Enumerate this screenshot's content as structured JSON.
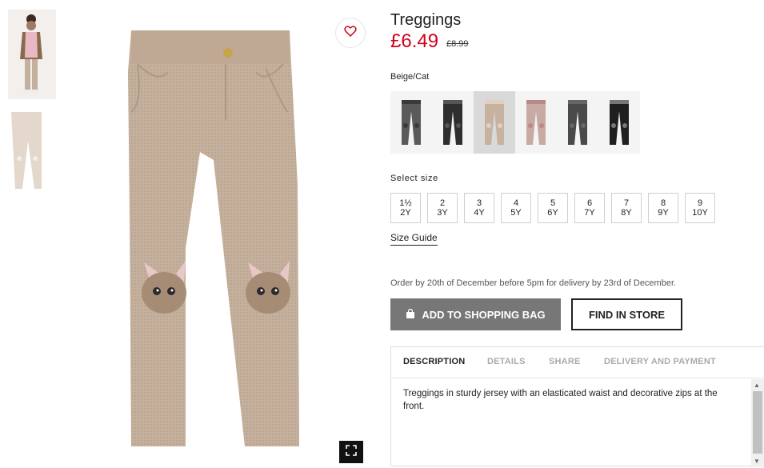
{
  "product": {
    "title": "Treggings",
    "price": "£6.49",
    "old_price": "£8.99",
    "color_name": "Beige/Cat"
  },
  "swatches": [
    {
      "color": "#5a5a5a",
      "knee": "#3a3a3a"
    },
    {
      "color": "#2e2e2e",
      "knee": "#555555"
    },
    {
      "color": "#c7b2a0",
      "knee": "#e0cfc2"
    },
    {
      "color": "#c9aaa2",
      "knee": "#b88"
    },
    {
      "color": "#4a4a4a",
      "knee": "#666"
    },
    {
      "color": "#1f1f1f",
      "knee": "#777"
    }
  ],
  "select_size_label": "Select size",
  "sizes": [
    {
      "a": "1½",
      "b": "2Y"
    },
    {
      "a": "2",
      "b": "3Y"
    },
    {
      "a": "3",
      "b": "4Y"
    },
    {
      "a": "4",
      "b": "5Y"
    },
    {
      "a": "5",
      "b": "6Y"
    },
    {
      "a": "6",
      "b": "7Y"
    },
    {
      "a": "7",
      "b": "8Y"
    },
    {
      "a": "8",
      "b": "9Y"
    },
    {
      "a": "9",
      "b": "10Y"
    }
  ],
  "size_guide": "Size Guide",
  "delivery_note": "Order by 20th of December before 5pm for delivery by 23rd of December.",
  "buttons": {
    "add_to_bag": "ADD TO SHOPPING BAG",
    "find_in_store": "FIND IN STORE"
  },
  "tabs": [
    "DESCRIPTION",
    "DETAILS",
    "SHARE",
    "DELIVERY AND PAYMENT"
  ],
  "description": "Treggings in sturdy jersey with an elasticated waist and decorative zips at the front.",
  "icons": {
    "favorite": "heart-icon",
    "expand": "expand-icon",
    "bag": "shopping-bag-icon"
  },
  "colors": {
    "sale_price": "#d0021b",
    "add_button": "#777777",
    "fabric": "#c4b09c"
  }
}
